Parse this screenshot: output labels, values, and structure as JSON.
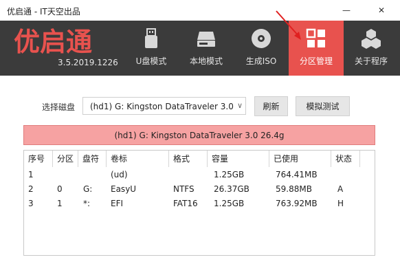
{
  "window": {
    "title": "优启通 - IT天空出品",
    "minimize_glyph": "—",
    "close_glyph": "✕"
  },
  "brand": {
    "logo_text": "优启通",
    "logo_color": "#e8524e",
    "version": "3.5.2019.1226"
  },
  "nav": {
    "items": [
      {
        "label": "U盘模式",
        "icon": "usb-drive-icon",
        "active": false
      },
      {
        "label": "本地模式",
        "icon": "hard-disk-icon",
        "active": false
      },
      {
        "label": "生成ISO",
        "icon": "disc-icon",
        "active": false
      },
      {
        "label": "分区管理",
        "icon": "grid-icon",
        "active": true
      },
      {
        "label": "关于程序",
        "icon": "cubes-icon",
        "active": false
      }
    ],
    "active_color": "#e8524e"
  },
  "disk_select": {
    "label": "选择磁盘",
    "value": "(hd1) G: Kingston DataTraveler 3.0 26.4g"
  },
  "buttons": {
    "refresh": "刷新",
    "simulate": "模拟测试"
  },
  "banner": {
    "text": "(hd1) G: Kingston DataTraveler 3.0 26.4g"
  },
  "table": {
    "headers": [
      "序号",
      "分区",
      "盘符",
      "卷标",
      "格式",
      "容量",
      "已使用",
      "状态"
    ],
    "rows": [
      [
        "1",
        "",
        "",
        "(ud)",
        "",
        "1.25GB",
        "764.41MB",
        ""
      ],
      [
        "2",
        "0",
        "G:",
        "EasyU",
        "NTFS",
        "26.37GB",
        "59.88MB",
        "A"
      ],
      [
        "3",
        "1",
        "*:",
        "EFI",
        "FAT16",
        "1.25GB",
        "763.92MB",
        "H"
      ]
    ]
  }
}
